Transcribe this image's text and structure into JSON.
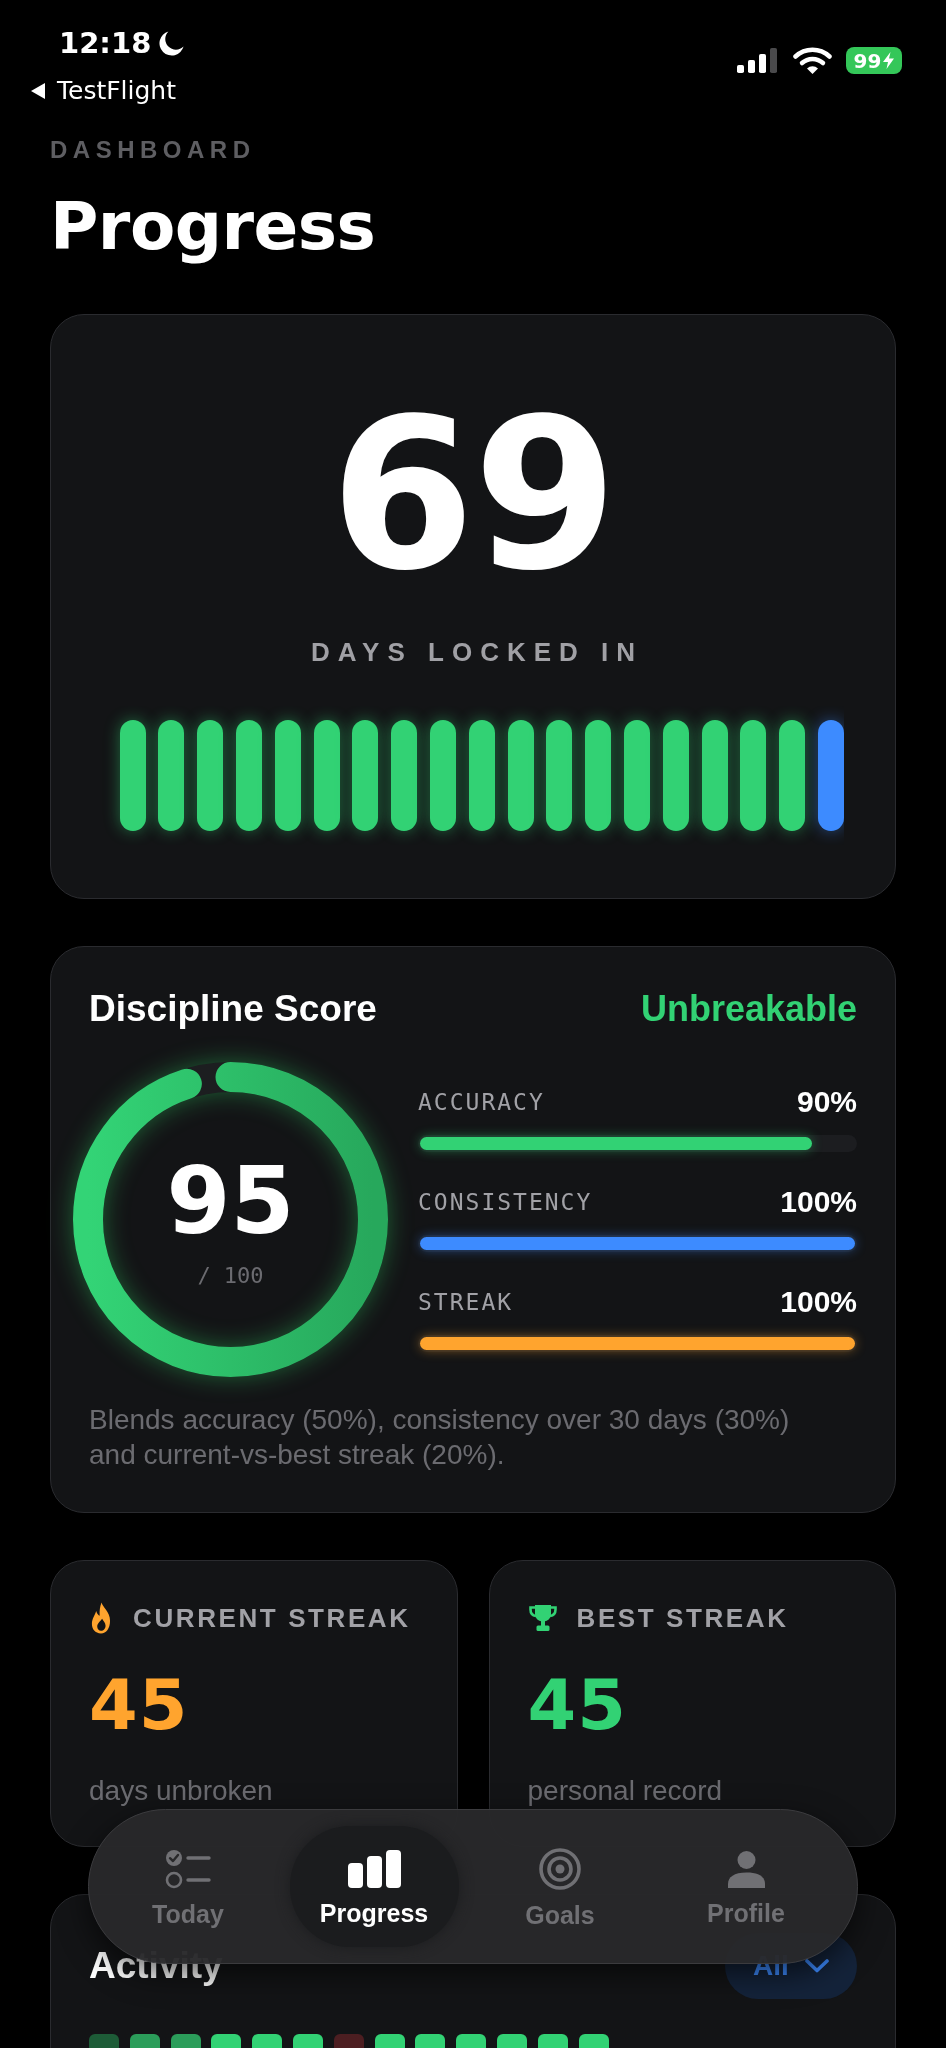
{
  "status_bar": {
    "time": "12:18",
    "back_label": "TestFlight",
    "battery": "99"
  },
  "header": {
    "eyebrow": "DASHBOARD",
    "title": "Progress"
  },
  "hero": {
    "count": "69",
    "label": "DAYS LOCKED IN",
    "days": [
      {
        "color": "#32d274"
      },
      {
        "color": "#32d274"
      },
      {
        "color": "#32d274"
      },
      {
        "color": "#32d274"
      },
      {
        "color": "#32d274"
      },
      {
        "color": "#32d274"
      },
      {
        "color": "#32d274"
      },
      {
        "color": "#32d274"
      },
      {
        "color": "#32d274"
      },
      {
        "color": "#32d274"
      },
      {
        "color": "#32d274"
      },
      {
        "color": "#32d274"
      },
      {
        "color": "#32d274"
      },
      {
        "color": "#32d274"
      },
      {
        "color": "#32d274"
      },
      {
        "color": "#32d274"
      },
      {
        "color": "#32d274"
      },
      {
        "color": "#32d274"
      },
      {
        "color": "#3d8bff"
      }
    ]
  },
  "score": {
    "title": "Discipline Score",
    "rating": "Unbreakable",
    "value": "95",
    "scale": "/ 100",
    "level": 0.95,
    "metrics": [
      {
        "label": "ACCURACY",
        "value": "90%",
        "level": 0.9,
        "color": "#32d274"
      },
      {
        "label": "CONSISTENCY",
        "value": "100%",
        "level": 1,
        "color": "#3d8bff"
      },
      {
        "label": "STREAK",
        "value": "100%",
        "level": 1,
        "color": "#ffa42e"
      }
    ],
    "note": "Blends accuracy (50%), consistency over 30 days (30%) and current-vs-best streak (20%)."
  },
  "streaks": [
    {
      "kind": "current",
      "label": "CURRENT STREAK",
      "value": "45",
      "caption": "days unbroken"
    },
    {
      "kind": "best",
      "label": "BEST STREAK",
      "value": "45",
      "caption": "personal record"
    }
  ],
  "activity": {
    "title": "Activity",
    "filter": "All",
    "days": [
      {
        "color": "#1d5c37"
      },
      {
        "color": "#2b9d5a"
      },
      {
        "color": "#2b9d5a"
      },
      {
        "color": "#32d274"
      },
      {
        "color": "#32d274"
      },
      {
        "color": "#32d274"
      },
      {
        "color": "#4c1e21"
      },
      {
        "color": "#32d274"
      },
      {
        "color": "#32d274"
      },
      {
        "color": "#32d274"
      },
      {
        "color": "#32d274"
      },
      {
        "color": "#32d274"
      },
      {
        "color": "#32d274"
      }
    ]
  },
  "tab_bar": {
    "tabs": [
      {
        "label": "Today",
        "selected": false
      },
      {
        "label": "Progress",
        "selected": true
      },
      {
        "label": "Goals",
        "selected": false
      },
      {
        "label": "Profile",
        "selected": false
      }
    ]
  }
}
